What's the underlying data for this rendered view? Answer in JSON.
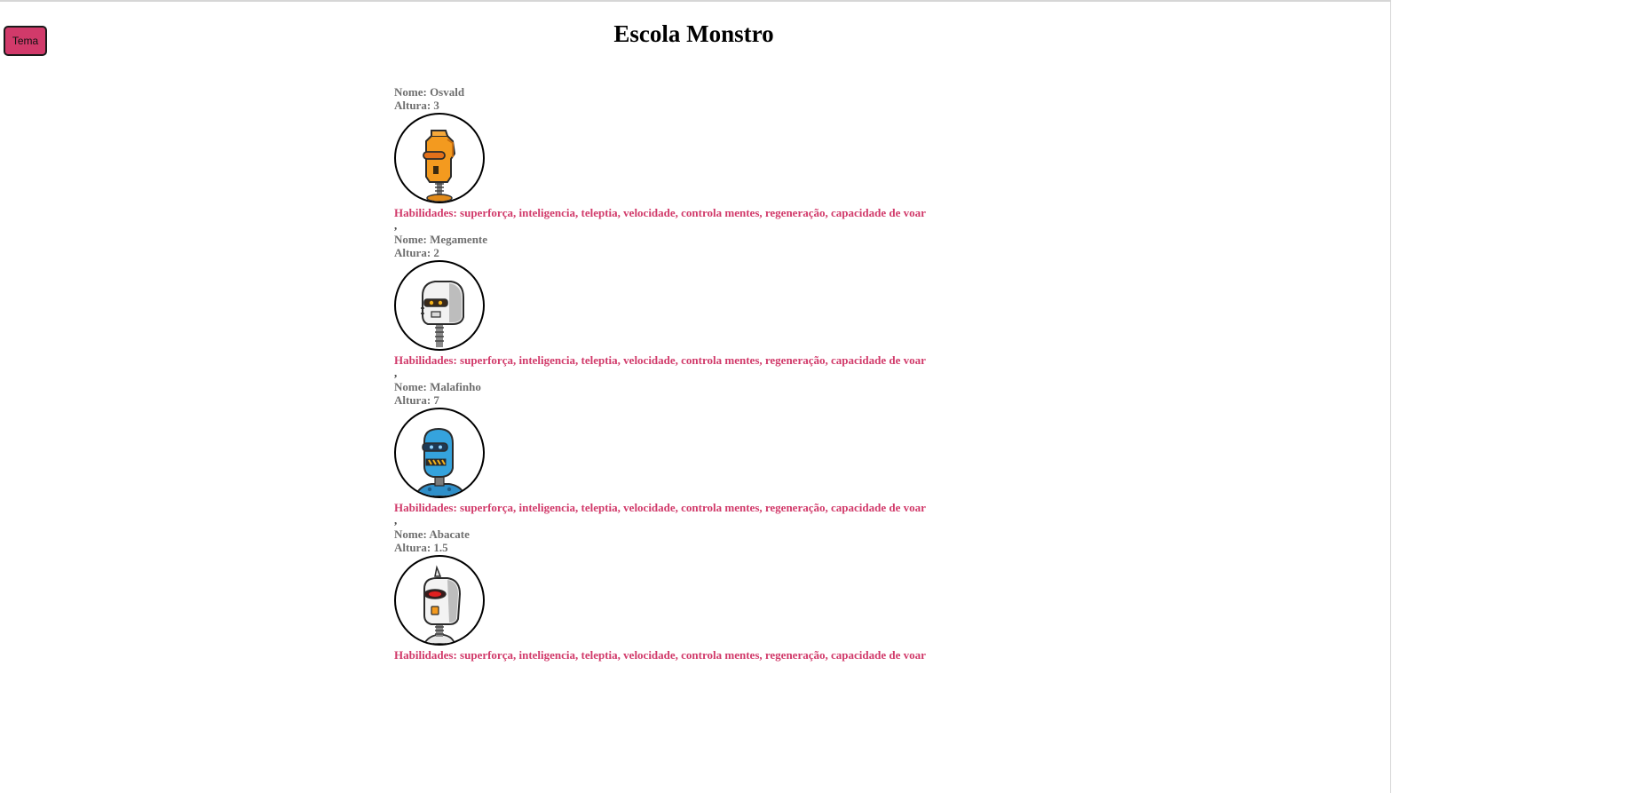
{
  "header": {
    "theme_button_label": "Tema",
    "title": "Escola Monstro"
  },
  "colors": {
    "accent": "#d13a6a",
    "label_gray": "#6f6f6f"
  },
  "monsters": [
    {
      "name": "Nome: Osvald",
      "height": "Altura: 3",
      "avatar_icon": "orange-robot-icon",
      "skills": "Habilidades: superforça, inteligencia, teleptia, velocidade, controla mentes, regeneração, capacidade de voar",
      "separator": ","
    },
    {
      "name": "Nome: Megamente",
      "height": "Altura: 2",
      "avatar_icon": "white-robot-icon",
      "skills": "Habilidades: superforça, inteligencia, teleptia, velocidade, controla mentes, regeneração, capacidade de voar",
      "separator": ","
    },
    {
      "name": "Nome: Malafinho",
      "height": "Altura: 7",
      "avatar_icon": "blue-robot-icon",
      "skills": "Habilidades: superforça, inteligencia, teleptia, velocidade, controla mentes, regeneração, capacidade de voar",
      "separator": ","
    },
    {
      "name": "Nome: Abacate",
      "height": "Altura: 1.5",
      "avatar_icon": "horned-robot-icon",
      "skills": "Habilidades: superforça, inteligencia, teleptia, velocidade, controla mentes, regeneração, capacidade de voar",
      "separator": ""
    }
  ]
}
